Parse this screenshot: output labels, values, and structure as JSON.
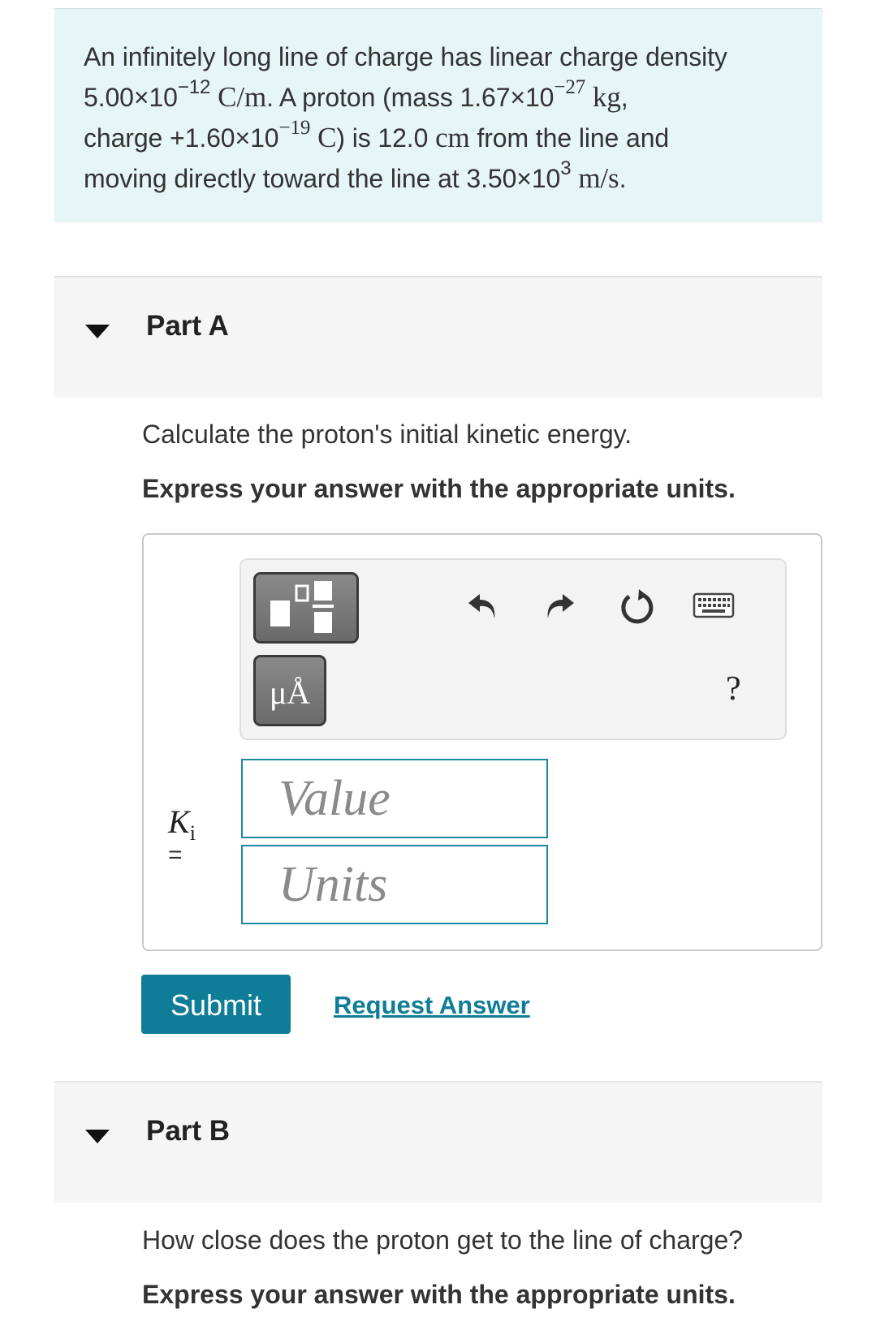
{
  "problem": {
    "line1": "An infinitely long line of charge has linear charge density",
    "line2_density_base": "5.00×10",
    "line2_density_exp": "−12",
    "line2_density_unit": "C/m",
    "line2_mid": ". A proton (mass 1.67",
    "line2_mass_base": "×10",
    "line2_mass_exp": "−27",
    "line2_mass_unit": "kg",
    "line2_end": ",",
    "line3_start": "charge +1.60",
    "line3_charge_base": "×10",
    "line3_charge_exp": "−19",
    "line3_charge_unit": "C",
    "line3_mid": ") is 12.0",
    "line3_dist_unit": "cm",
    "line3_end": "from the line and",
    "line4_start": "moving directly toward the line at 3.50×10",
    "line4_exp": "3",
    "line4_unit": "m/s",
    "line4_end": "."
  },
  "partA": {
    "title": "Part A",
    "question": "Calculate the proton's initial kinetic energy.",
    "instruction": "Express your answer with the appropriate units.",
    "units_button": "μÅ",
    "help": "?",
    "answer_label_var": "K",
    "answer_label_sub": "i",
    "answer_label_eq": "=",
    "value_placeholder": "Value",
    "units_placeholder": "Units",
    "submit": "Submit",
    "request_answer": "Request Answer"
  },
  "partB": {
    "title": "Part B",
    "question": "How close does the proton get to the line of charge?",
    "instruction": "Express your answer with the appropriate units."
  },
  "icons": [
    "fraction-template-icon",
    "undo-icon",
    "redo-icon",
    "reset-icon",
    "keyboard-icon"
  ],
  "colors": {
    "problem_bg": "#e6f5f6",
    "accent": "#0f7d98",
    "field_border": "#1a8aa0"
  }
}
